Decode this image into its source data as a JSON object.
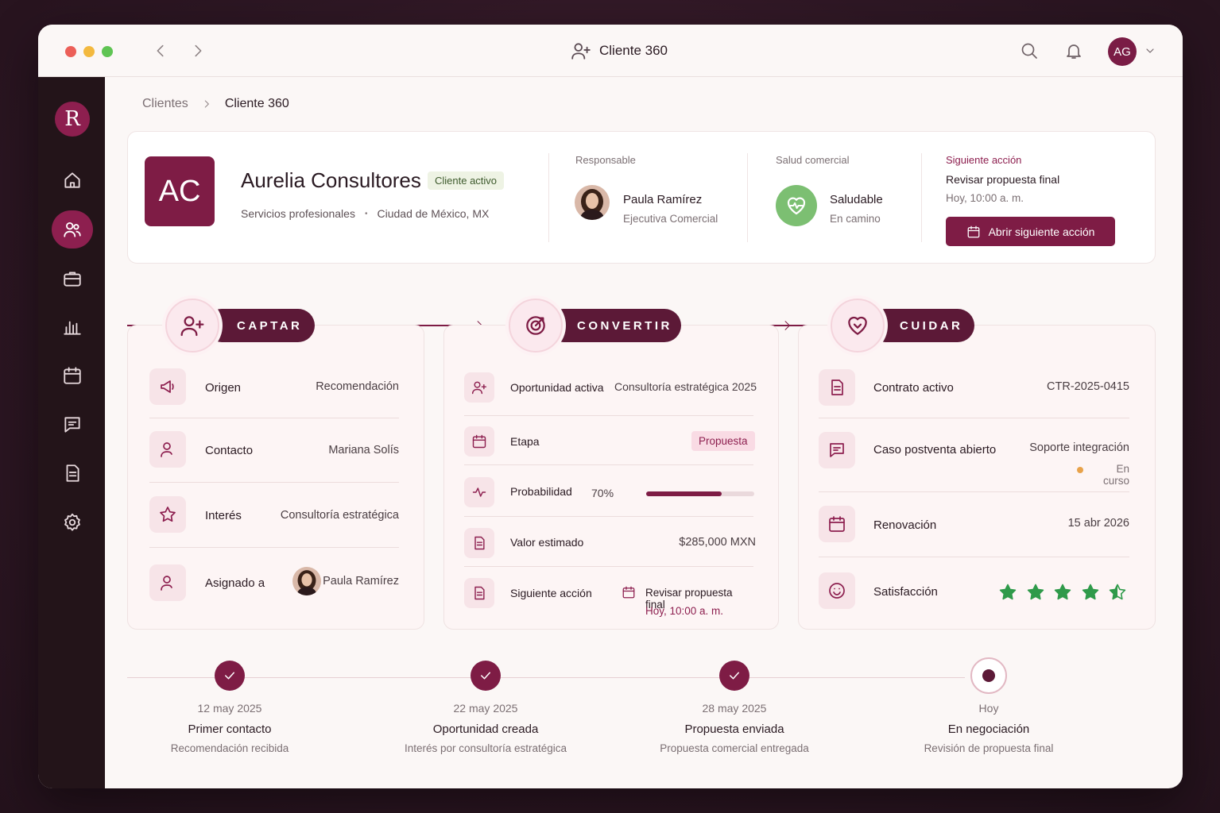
{
  "window": {
    "title": "Cliente 360",
    "user_initials": "AG"
  },
  "breadcrumb": {
    "parent": "Clientes",
    "current": "Cliente 360"
  },
  "brand": {
    "letter": "R"
  },
  "client": {
    "initials": "AC",
    "name": "Aurelia Consultores",
    "badge": "Cliente activo",
    "industry": "Servicios profesionales",
    "location": "Ciudad de México, MX"
  },
  "owner": {
    "label": "Responsable",
    "name": "Paula Ramírez",
    "role": "Ejecutiva Comercial"
  },
  "health": {
    "label": "Salud comercial",
    "status": "Saludable",
    "sub": "En camino"
  },
  "next_action": {
    "label": "Siguiente acción",
    "text": "Revisar propuesta final",
    "time": "Hoy, 10:00 a. m.",
    "button": "Abrir siguiente acción"
  },
  "stages": {
    "captar": {
      "title": "CAPTAR",
      "rows": [
        {
          "label": "Origen",
          "value": "Recomendación"
        },
        {
          "label": "Contacto",
          "value": "Mariana Solís"
        },
        {
          "label": "Interés",
          "value": "Consultoría estratégica"
        },
        {
          "label": "Asignado a",
          "value": "Paula Ramírez"
        }
      ]
    },
    "convertir": {
      "title": "CONVERTIR",
      "rows": [
        {
          "label": "Oportunidad activa",
          "value": "Consultoría estratégica 2025"
        },
        {
          "label": "Etapa",
          "value": "Propuesta"
        },
        {
          "label": "Probabilidad",
          "value": "70%",
          "progress": 0.7
        },
        {
          "label": "Valor estimado",
          "value": "$285,000 MXN"
        },
        {
          "label": "Siguiente acción",
          "value": "Revisar propuesta final",
          "sub": "Hoy, 10:00 a. m."
        }
      ]
    },
    "cuidar": {
      "title": "CUIDAR",
      "rows": [
        {
          "label": "Contrato activo",
          "value": "CTR-2025-0415"
        },
        {
          "label": "Caso postventa abierto",
          "value": "Soporte integración",
          "status": "En curso"
        },
        {
          "label": "Renovación",
          "value": "15 abr 2026"
        },
        {
          "label": "Satisfacción",
          "rating": 4.5,
          "max": 5
        }
      ]
    }
  },
  "timeline": [
    {
      "date": "12 may 2025",
      "title": "Primer contacto",
      "sub": "Recomendación recibida",
      "state": "done"
    },
    {
      "date": "22 may 2025",
      "title": "Oportunidad creada",
      "sub": "Interés por consultoría estratégica",
      "state": "done"
    },
    {
      "date": "28 may 2025",
      "title": "Propuesta enviada",
      "sub": "Propuesta comercial entregada",
      "state": "done"
    },
    {
      "date": "Hoy",
      "title": "En negociación",
      "sub": "Revisión de propuesta final",
      "state": "current"
    }
  ],
  "colors": {
    "brand": "#7e1c45",
    "sidebar": "#231419",
    "health": "#7cbf72",
    "stars": "#2f9a4a",
    "status_dot": "#e8a24a"
  },
  "icons": {
    "sidebar": [
      "home-icon",
      "users-icon",
      "briefcase-icon",
      "chart-icon",
      "calendar-icon",
      "chat-icon",
      "document-icon",
      "settings-icon"
    ],
    "topbar": [
      "search-icon",
      "bell-icon",
      "chevron-down-icon"
    ]
  }
}
